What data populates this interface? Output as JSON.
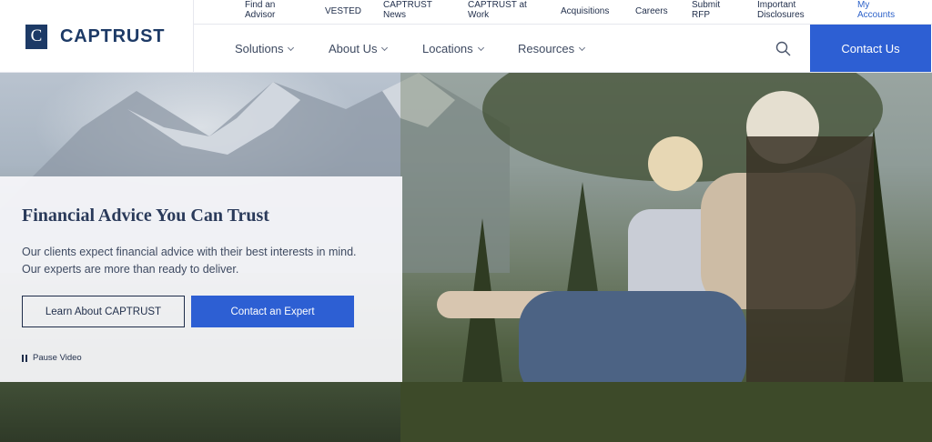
{
  "brand": {
    "mark": "C",
    "name": "CAPTRUST"
  },
  "utility_links": [
    {
      "line1": "Find an",
      "line2": "Advisor"
    },
    {
      "line1": "VESTED",
      "line2": ""
    },
    {
      "line1": "CAPTRUST",
      "line2": "News"
    },
    {
      "line1": "CAPTRUST at",
      "line2": "Work"
    },
    {
      "line1": "Acquisitions",
      "line2": ""
    },
    {
      "line1": "Careers",
      "line2": ""
    },
    {
      "line1": "Submit",
      "line2": "RFP"
    },
    {
      "line1": "Important",
      "line2": "Disclosures"
    },
    {
      "line1": "My",
      "line2": "Accounts"
    }
  ],
  "nav": {
    "items": [
      "Solutions",
      "About Us",
      "Locations",
      "Resources"
    ],
    "search_icon": "search-icon",
    "contact_label": "Contact Us"
  },
  "hero": {
    "title": "Financial Advice You Can Trust",
    "text": "Our clients expect financial advice with their best interests in mind. Our experts are more than ready to deliver.",
    "learn_label": "Learn About CAPTRUST",
    "contact_label": "Contact an Expert",
    "pause_label": "Pause Video"
  },
  "colors": {
    "primary": "#2d5fd3",
    "navy": "#1d3a66",
    "text": "#1f2d4a"
  }
}
